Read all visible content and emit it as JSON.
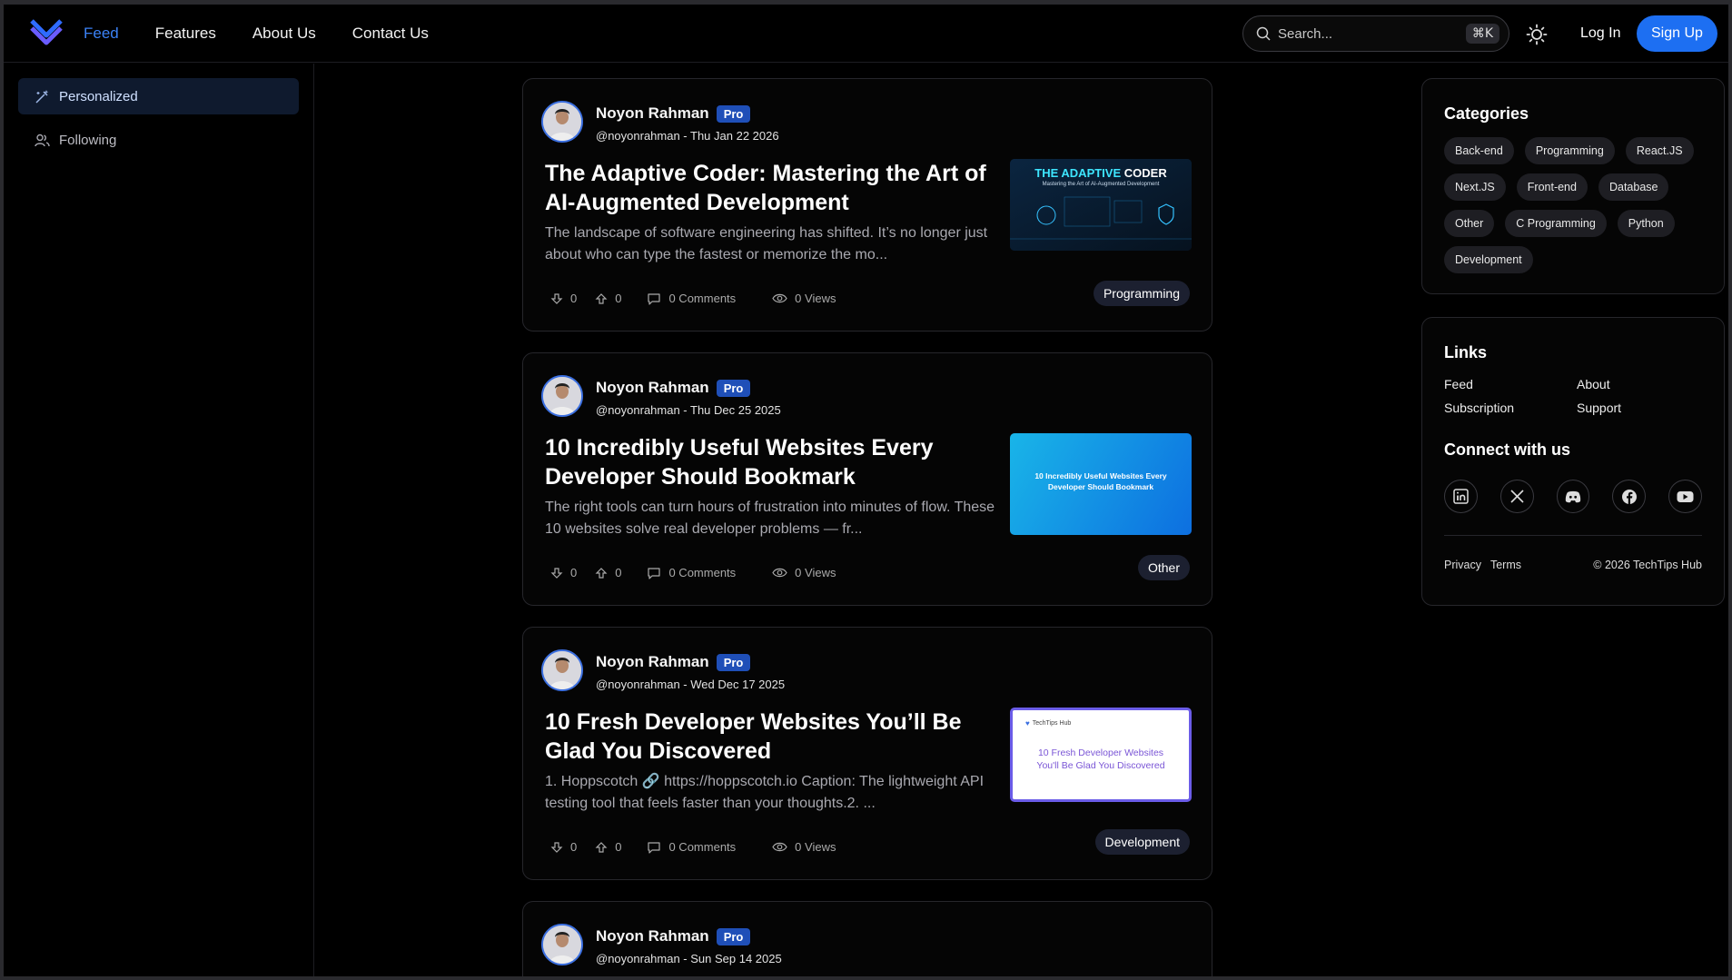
{
  "header": {
    "nav": [
      {
        "label": "Feed"
      },
      {
        "label": "Features"
      },
      {
        "label": "About Us"
      },
      {
        "label": "Contact Us"
      }
    ],
    "search_placeholder": "Search...",
    "search_shortcut": "⌘K",
    "login_label": "Log In",
    "signup_label": "Sign Up",
    "accent_color": "#1d6ff2"
  },
  "sidebar": {
    "items": [
      {
        "label": "Personalized",
        "icon": "magic-wand-icon"
      },
      {
        "label": "Following",
        "icon": "users-icon"
      }
    ]
  },
  "posts": [
    {
      "author": "Noyon Rahman",
      "badge": "Pro",
      "meta": "@noyonrahman - Thu Jan 22 2026",
      "title": "The Adaptive Coder: Mastering the Art of AI-Augmented Development",
      "excerpt": "The landscape of software engineering has shifted. It’s no longer just about who can type the fastest or memorize the mo...",
      "downvotes": "0",
      "upvotes": "0",
      "comments": "0 Comments",
      "views": "0 Views",
      "tag": "Programming",
      "thumb_title_a": "THE ADAPTIVE",
      "thumb_title_b": "CODER",
      "thumb_subtitle": "Mastering the Art of AI-Augmented Development"
    },
    {
      "author": "Noyon Rahman",
      "badge": "Pro",
      "meta": "@noyonrahman - Thu Dec 25 2025",
      "title": "10 Incredibly Useful Websites Every Developer Should Bookmark",
      "excerpt": "The right tools can turn hours of frustration into minutes of flow. These 10 websites solve real developer problems — fr...",
      "downvotes": "0",
      "upvotes": "0",
      "comments": "0 Comments",
      "views": "0 Views",
      "tag": "Other",
      "thumb_title": "10 Incredibly Useful Websites Every Developer Should Bookmark"
    },
    {
      "author": "Noyon Rahman",
      "badge": "Pro",
      "meta": "@noyonrahman - Wed Dec 17 2025",
      "title": "10 Fresh Developer Websites You’ll Be Glad You Discovered",
      "excerpt": "1. Hoppscotch 🔗 https://hoppscotch.io Caption: The lightweight API testing tool that feels faster than your thoughts.2. ...",
      "downvotes": "0",
      "upvotes": "0",
      "comments": "0 Comments",
      "views": "0 Views",
      "tag": "Development",
      "thumb_brand": "TechTips Hub",
      "thumb_title": "10 Fresh Developer Websites You'll Be Glad You Discovered"
    },
    {
      "author": "Noyon Rahman",
      "badge": "Pro",
      "meta": "@noyonrahman - Sun Sep 14 2025"
    }
  ],
  "categories": {
    "title": "Categories",
    "items": [
      "Back-end",
      "Programming",
      "React.JS",
      "Next.JS",
      "Front-end",
      "Database",
      "Other",
      "C Programming",
      "Python",
      "Development"
    ]
  },
  "links": {
    "title": "Links",
    "items": [
      "Feed",
      "About",
      "Subscription",
      "Support"
    ],
    "connect_title": "Connect with us",
    "privacy": "Privacy",
    "terms": "Terms",
    "copyright": "© 2026 TechTips Hub"
  }
}
